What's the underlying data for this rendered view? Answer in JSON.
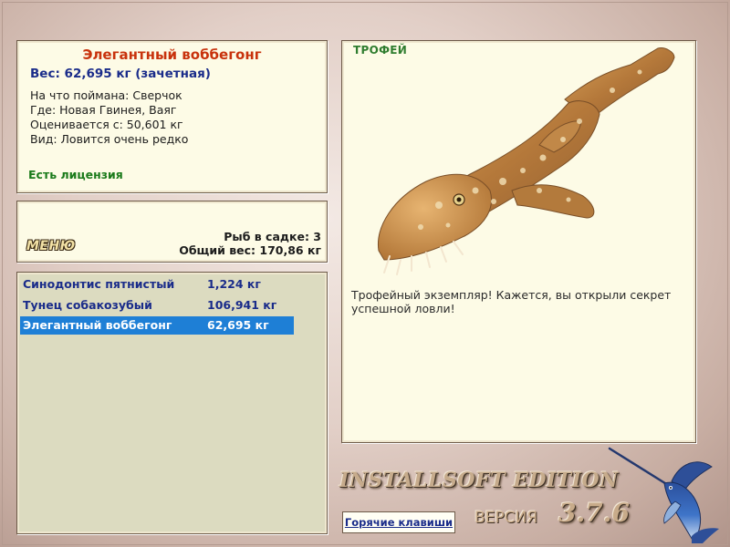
{
  "info": {
    "fish_name": "Элегантный воббегонг",
    "weight": "Вес: 62,695 кг (зачетная)",
    "caught_on": "На что поймана: Сверчок",
    "location": "Где: Новая Гвинея, Ваяг",
    "valued_from": "Оценивается с: 50,601 кг",
    "species_rarity": "Вид: Ловится очень редко",
    "license": "Есть лицензия"
  },
  "menu": {
    "label": "МЕНЮ",
    "fish_in_keepnet": "Рыб в садке: 3",
    "total_weight": "Общий вес: 170,86 кг"
  },
  "catch_list": [
    {
      "name": "Синодонтис пятнистый",
      "weight": "1,224 кг",
      "selected": false
    },
    {
      "name": "Тунец собакозубый",
      "weight": "106,941 кг",
      "selected": false
    },
    {
      "name": "Элегантный воббегонг",
      "weight": "62,695 кг",
      "selected": true
    }
  ],
  "trophy": {
    "badge": "ТРОФЕЙ",
    "description": "Трофейный экземпляр! Кажется, вы открыли секрет успешной ловли!",
    "image": "wobbegong-shark"
  },
  "footer": {
    "edition": "INSTALLSOFT EDITION",
    "version_label": "ВЕРСИЯ",
    "version_number": "3.7.6",
    "hotkeys": "Горячие клавиши",
    "logo": "marlin-logo"
  },
  "colors": {
    "panel_bg": "#fdfbe6",
    "list_bg": "#dcdbc0",
    "selection": "#1e7fd6",
    "title_red": "#c8320c",
    "text_blue": "#1a2c8a",
    "license_green": "#1a7a1a"
  }
}
